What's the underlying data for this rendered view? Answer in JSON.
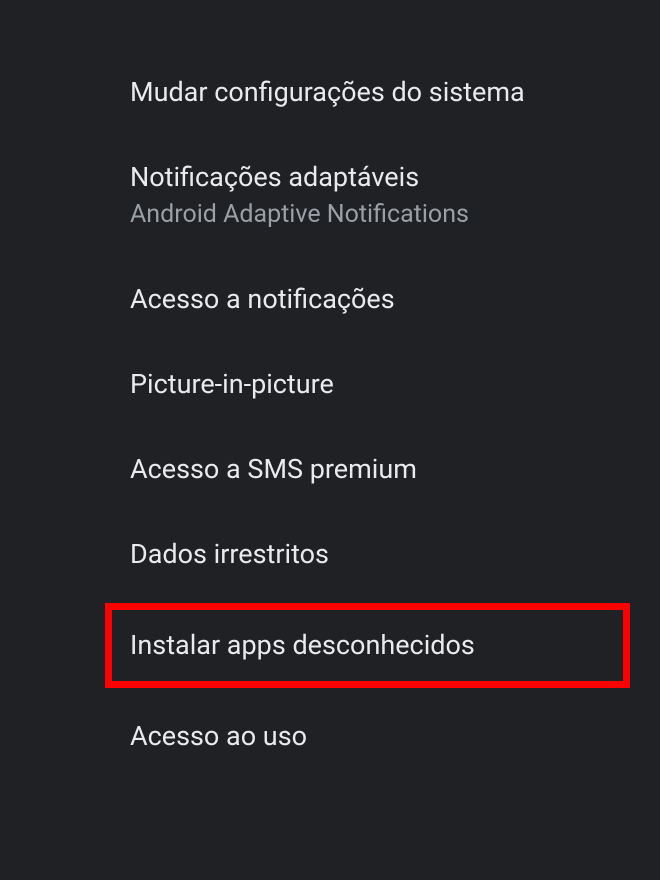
{
  "settings": {
    "items": [
      {
        "title": "Mudar configurações do sistema",
        "subtitle": null,
        "highlighted": false
      },
      {
        "title": "Notificações adaptáveis",
        "subtitle": "Android Adaptive Notifications",
        "highlighted": false
      },
      {
        "title": "Acesso a notificações",
        "subtitle": null,
        "highlighted": false
      },
      {
        "title": "Picture-in-picture",
        "subtitle": null,
        "highlighted": false
      },
      {
        "title": "Acesso a SMS premium",
        "subtitle": null,
        "highlighted": false
      },
      {
        "title": "Dados irrestritos",
        "subtitle": null,
        "highlighted": false
      },
      {
        "title": "Instalar apps desconhecidos",
        "subtitle": null,
        "highlighted": true
      },
      {
        "title": "Acesso ao uso",
        "subtitle": null,
        "highlighted": false
      }
    ]
  }
}
